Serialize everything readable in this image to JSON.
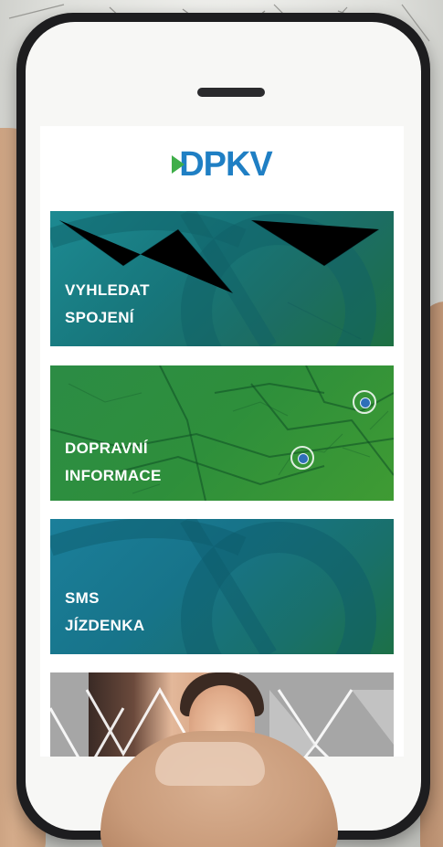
{
  "app": {
    "logo_text": "DPKV",
    "brand_blue": "#1f7fc4",
    "brand_green": "#3fae49"
  },
  "menu": {
    "tiles": [
      {
        "line1": "VYHLEDAT",
        "line2": "SPOJENÍ",
        "color": "#17767b"
      },
      {
        "line1": "DOPRAVNÍ",
        "line2": "INFORMACE",
        "color": "#2e8f3b"
      },
      {
        "line1": "SMS",
        "line2": "JÍZDENKA",
        "color": "#17748a"
      }
    ]
  },
  "icons": {
    "logo_mark": "play-triangle-icon",
    "map_pin": "location-pin-icon"
  }
}
